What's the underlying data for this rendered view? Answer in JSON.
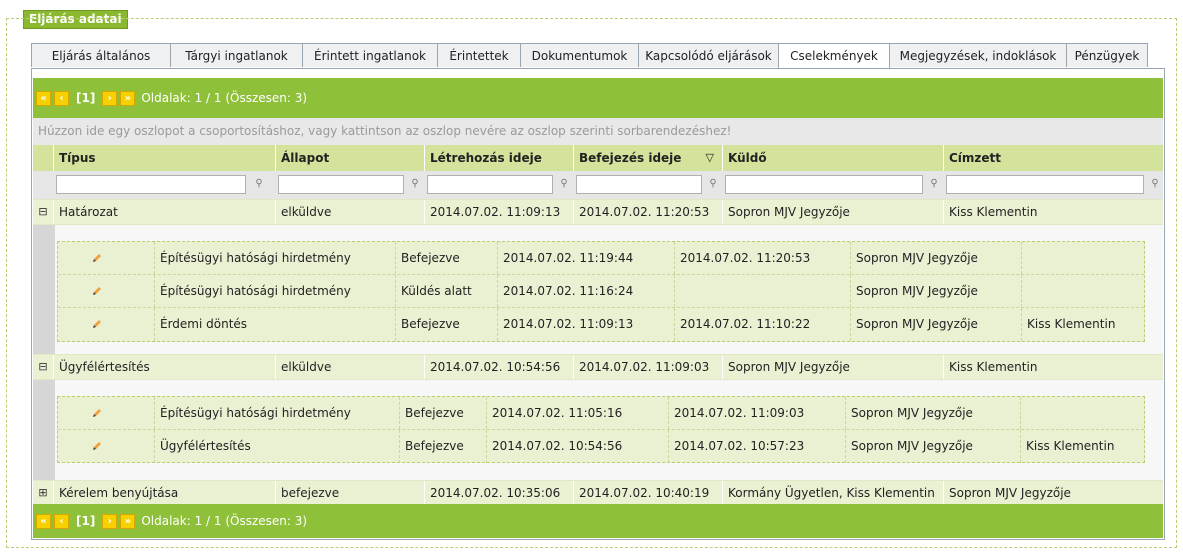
{
  "legend": "Eljárás adatai",
  "tabs": [
    {
      "label": "Eljárás általános adatai",
      "active": false
    },
    {
      "label": "Tárgyi ingatlanok",
      "active": false
    },
    {
      "label": "Érintett ingatlanok",
      "active": false
    },
    {
      "label": "Érintettek",
      "active": false
    },
    {
      "label": "Dokumentumok",
      "active": false
    },
    {
      "label": "Kapcsolódó eljárások",
      "active": false
    },
    {
      "label": "Cselekmények",
      "active": true
    },
    {
      "label": "Megjegyzések, indoklások",
      "active": false
    },
    {
      "label": "Pénzügyek",
      "active": false
    }
  ],
  "pager": {
    "first": "«",
    "prev": "‹",
    "current": "[1]",
    "next": "›",
    "last": "»",
    "info": "Oldalak: 1 / 1 (Összesen: 3)"
  },
  "grid": {
    "group_hint": "Húzzon ide egy oszlopot a csoportosításhoz, vagy kattintson az oszlop nevére az oszlop szerinti sorbarendezéshez!",
    "columns": [
      "Típus",
      "Állapot",
      "Létrehozás ideje",
      "Befejezés ideje",
      "Küldő",
      "Címzett"
    ],
    "sort_indicator": "▽",
    "rows": [
      {
        "expander": "⊟",
        "type": "Határozat",
        "status": "elküldve",
        "created": "2014.07.02. 11:09:13",
        "finished": "2014.07.02. 11:20:53",
        "sender": "Sopron MJV Jegyzője",
        "recipient": "Kiss Klementin",
        "children": [
          {
            "title": "Építésügyi hatósági hirdetmény",
            "status": "Befejezve",
            "created": "2014.07.02. 11:19:44",
            "finished": "2014.07.02. 11:20:53",
            "sender": "Sopron MJV Jegyzője",
            "recipient": ""
          },
          {
            "title": "Építésügyi hatósági hirdetmény",
            "status": "Küldés alatt",
            "created": "2014.07.02. 11:16:24",
            "finished": "",
            "sender": "Sopron MJV Jegyzője",
            "recipient": ""
          },
          {
            "title": "Érdemi döntés",
            "status": "Befejezve",
            "created": "2014.07.02. 11:09:13",
            "finished": "2014.07.02. 11:10:22",
            "sender": "Sopron MJV Jegyzője",
            "recipient": "Kiss Klementin"
          }
        ]
      },
      {
        "expander": "⊟",
        "type": "Ügyfélértesítés",
        "status": "elküldve",
        "created": "2014.07.02. 10:54:56",
        "finished": "2014.07.02. 11:09:03",
        "sender": "Sopron MJV Jegyzője",
        "recipient": "Kiss Klementin",
        "children": [
          {
            "title": "Építésügyi hatósági hirdetmény",
            "status": "Befejezve",
            "created": "2014.07.02. 11:05:16",
            "finished": "2014.07.02. 11:09:03",
            "sender": "Sopron MJV Jegyzője",
            "recipient": ""
          },
          {
            "title": "Ügyfélértesítés",
            "status": "Befejezve",
            "created": "2014.07.02. 10:54:56",
            "finished": "2014.07.02. 10:57:23",
            "sender": "Sopron MJV Jegyzője",
            "recipient": "Kiss Klementin"
          }
        ]
      },
      {
        "expander": "⊞",
        "type": "Kérelem benyújtása",
        "status": "befejezve",
        "created": "2014.07.02. 10:35:06",
        "finished": "2014.07.02. 10:40:19",
        "sender": "Kormány Ügyetlen, Kiss Klementin",
        "recipient": "Sopron MJV Jegyzője",
        "children": []
      }
    ]
  },
  "icons": {
    "edit": "pencil-icon",
    "filter": "filter-icon"
  },
  "colors": {
    "pager_bg": "#8fc03a",
    "header_bg": "#d3e39c",
    "row_bg": "#eaf1d3",
    "pager_button": "#f6d000"
  }
}
